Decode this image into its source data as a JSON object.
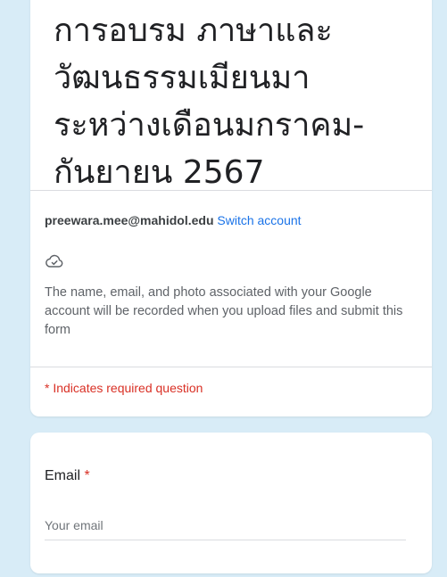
{
  "form": {
    "title": "การอบรม ภาษาและวัฒนธรรมเมียนมา ระหว่างเดือนมกราคม-กันยายน 2567",
    "account": {
      "email": "preewara.mee@mahidol.edu",
      "switch_label": "Switch account"
    },
    "cloud_icon": "cloud-check-icon",
    "notice": "The name, email, and photo associated with your Google account will be recorded when you upload files and submit this form",
    "required_note": "* Indicates required question"
  },
  "question": {
    "label": "Email",
    "required_marker": "*",
    "placeholder": "Your email",
    "value": ""
  },
  "colors": {
    "background": "#d8ecf7",
    "link": "#1a73e8",
    "required": "#d93025"
  }
}
